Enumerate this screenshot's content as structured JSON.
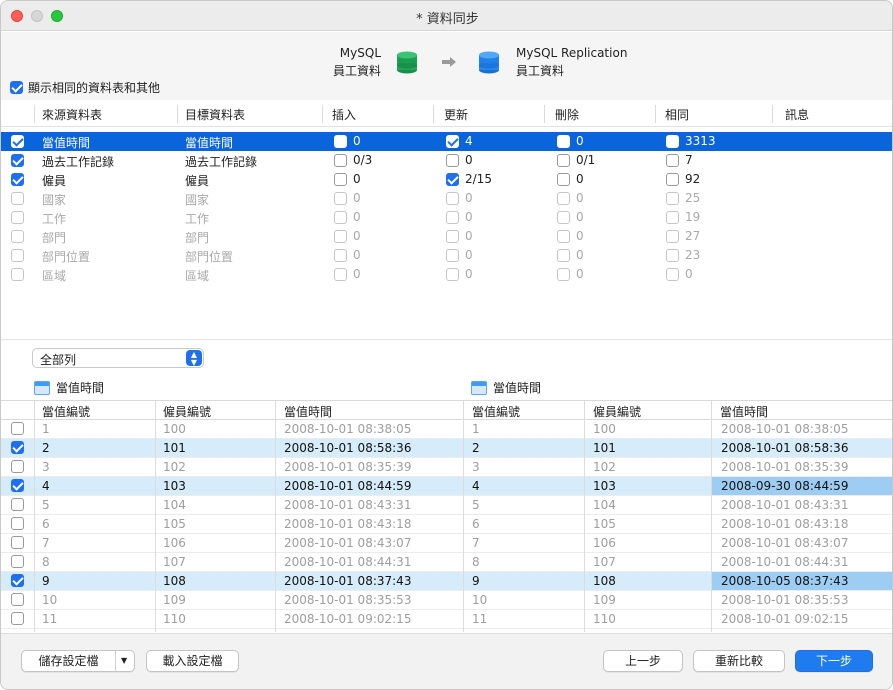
{
  "window": {
    "title": "* 資料同步"
  },
  "source": {
    "server": "MySQL",
    "database": "員工資料"
  },
  "target": {
    "server": "MySQL Replication",
    "database": "員工資料"
  },
  "show_same_option": {
    "label": "顯示相同的資料表和其他",
    "checked": true
  },
  "table_headers": [
    "來源資料表",
    "目標資料表",
    "插入",
    "更新",
    "刪除",
    "相同",
    "訊息"
  ],
  "table_rows": [
    {
      "checked": true,
      "source": "當值時間",
      "target": "當值時間",
      "insert": "0",
      "insert_chk": false,
      "update": "4",
      "update_chk": true,
      "delete": "0",
      "delete_chk": false,
      "same": "3313",
      "same_chk": false,
      "state": "selected"
    },
    {
      "checked": true,
      "source": "過去工作記錄",
      "target": "過去工作記錄",
      "insert": "0/3",
      "insert_chk": false,
      "update": "0",
      "update_chk": false,
      "delete": "0/1",
      "delete_chk": false,
      "same": "7",
      "same_chk": false,
      "state": "normal"
    },
    {
      "checked": true,
      "source": "僱員",
      "target": "僱員",
      "insert": "0",
      "insert_chk": false,
      "update": "2/15",
      "update_chk": true,
      "delete": "0",
      "delete_chk": false,
      "same": "92",
      "same_chk": false,
      "state": "normal"
    },
    {
      "checked": false,
      "source": "國家",
      "target": "國家",
      "insert": "0",
      "insert_chk": false,
      "update": "0",
      "update_chk": false,
      "delete": "0",
      "delete_chk": false,
      "same": "25",
      "same_chk": false,
      "state": "dim"
    },
    {
      "checked": false,
      "source": "工作",
      "target": "工作",
      "insert": "0",
      "insert_chk": false,
      "update": "0",
      "update_chk": false,
      "delete": "0",
      "delete_chk": false,
      "same": "19",
      "same_chk": false,
      "state": "dim"
    },
    {
      "checked": false,
      "source": "部門",
      "target": "部門",
      "insert": "0",
      "insert_chk": false,
      "update": "0",
      "update_chk": false,
      "delete": "0",
      "delete_chk": false,
      "same": "27",
      "same_chk": false,
      "state": "dim"
    },
    {
      "checked": false,
      "source": "部門位置",
      "target": "部門位置",
      "insert": "0",
      "insert_chk": false,
      "update": "0",
      "update_chk": false,
      "delete": "0",
      "delete_chk": false,
      "same": "23",
      "same_chk": false,
      "state": "dim"
    },
    {
      "checked": false,
      "source": "區域",
      "target": "區域",
      "insert": "0",
      "insert_chk": false,
      "update": "0",
      "update_chk": false,
      "delete": "0",
      "delete_chk": false,
      "same": "0",
      "same_chk": false,
      "state": "dim"
    }
  ],
  "row_filter": {
    "selected": "全部列"
  },
  "left_table": {
    "name": "當值時間"
  },
  "right_table": {
    "name": "當值時間"
  },
  "grid_headers": [
    "當值編號",
    "僱員編號",
    "當值時間",
    "當值編號",
    "僱員編號",
    "當值時間"
  ],
  "grid_rows": [
    {
      "checked": false,
      "diff": false,
      "l": [
        "1",
        "100",
        "2008-10-01 08:38:05"
      ],
      "r": [
        "1",
        "100",
        "2008-10-01 08:38:05"
      ],
      "r_time_changed": false
    },
    {
      "checked": true,
      "diff": true,
      "l": [
        "2",
        "101",
        "2008-10-01 08:58:36"
      ],
      "r": [
        "2",
        "101",
        "2008-10-01 08:58:36"
      ],
      "r_time_changed": false
    },
    {
      "checked": false,
      "diff": false,
      "l": [
        "3",
        "102",
        "2008-10-01 08:35:39"
      ],
      "r": [
        "3",
        "102",
        "2008-10-01 08:35:39"
      ],
      "r_time_changed": false
    },
    {
      "checked": true,
      "diff": true,
      "l": [
        "4",
        "103",
        "2008-10-01 08:44:59"
      ],
      "r": [
        "4",
        "103",
        "2008-09-30 08:44:59"
      ],
      "r_time_changed": true
    },
    {
      "checked": false,
      "diff": false,
      "l": [
        "5",
        "104",
        "2008-10-01 08:43:31"
      ],
      "r": [
        "5",
        "104",
        "2008-10-01 08:43:31"
      ],
      "r_time_changed": false
    },
    {
      "checked": false,
      "diff": false,
      "l": [
        "6",
        "105",
        "2008-10-01 08:43:18"
      ],
      "r": [
        "6",
        "105",
        "2008-10-01 08:43:18"
      ],
      "r_time_changed": false
    },
    {
      "checked": false,
      "diff": false,
      "l": [
        "7",
        "106",
        "2008-10-01 08:43:07"
      ],
      "r": [
        "7",
        "106",
        "2008-10-01 08:43:07"
      ],
      "r_time_changed": false
    },
    {
      "checked": false,
      "diff": false,
      "l": [
        "8",
        "107",
        "2008-10-01 08:44:31"
      ],
      "r": [
        "8",
        "107",
        "2008-10-01 08:44:31"
      ],
      "r_time_changed": false
    },
    {
      "checked": true,
      "diff": true,
      "l": [
        "9",
        "108",
        "2008-10-01 08:37:43"
      ],
      "r": [
        "9",
        "108",
        "2008-10-05 08:37:43"
      ],
      "r_time_changed": true
    },
    {
      "checked": false,
      "diff": false,
      "l": [
        "10",
        "109",
        "2008-10-01 08:35:53"
      ],
      "r": [
        "10",
        "109",
        "2008-10-01 08:35:53"
      ],
      "r_time_changed": false
    },
    {
      "checked": false,
      "diff": false,
      "l": [
        "11",
        "110",
        "2008-10-01 09:02:15"
      ],
      "r": [
        "11",
        "110",
        "2008-10-01 09:02:15"
      ],
      "r_time_changed": false
    }
  ],
  "buttons": {
    "save_profile": "儲存設定檔",
    "load_profile": "載入設定檔",
    "back": "上一步",
    "recompare": "重新比較",
    "next": "下一步"
  },
  "colors": {
    "selection": "#0a64dc",
    "diff_row": "#d6ecfa",
    "changed_cell": "#9dcdf2",
    "accent": "#1f7cf0"
  }
}
